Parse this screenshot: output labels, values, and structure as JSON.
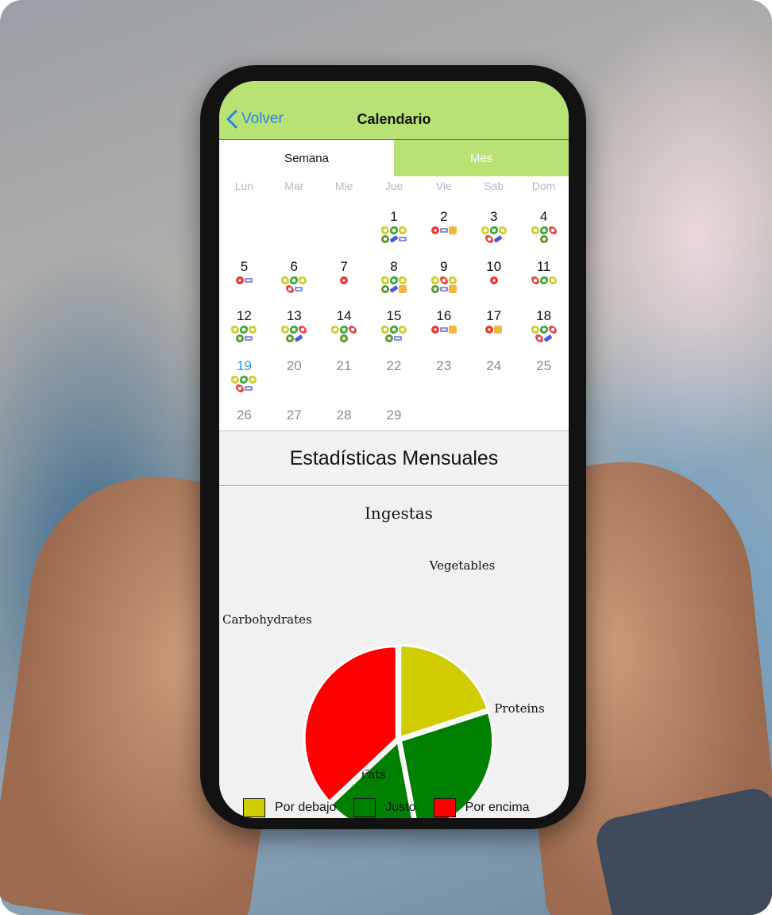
{
  "navbar": {
    "back_label": "Volver",
    "title": "Calendario"
  },
  "tabs": [
    {
      "label": "Semana",
      "active": true
    },
    {
      "label": "Mes",
      "active": false
    }
  ],
  "weekdays": [
    "Lun",
    "Mar",
    "Mie",
    "Jue",
    "Vie",
    "Sab",
    "Dom"
  ],
  "calendar": {
    "days": [
      {
        "day": "",
        "icons": []
      },
      {
        "day": "",
        "icons": []
      },
      {
        "day": "",
        "icons": []
      },
      {
        "day": "1",
        "state": "past",
        "icons": [
          "veg",
          "prot",
          "veg",
          "fat",
          "sport",
          "gym"
        ]
      },
      {
        "day": "2",
        "state": "past",
        "icons": [
          "none",
          "gym",
          "beer"
        ]
      },
      {
        "day": "3",
        "state": "past",
        "icons": [
          "veg",
          "prot",
          "veg",
          "carb",
          "sport"
        ]
      },
      {
        "day": "4",
        "state": "past",
        "icons": [
          "veg",
          "prot",
          "carb",
          "fat"
        ]
      },
      {
        "day": "5",
        "state": "past",
        "icons": [
          "none",
          "gym"
        ]
      },
      {
        "day": "6",
        "state": "past",
        "icons": [
          "veg",
          "prot",
          "veg",
          "carb",
          "gym"
        ]
      },
      {
        "day": "7",
        "state": "past",
        "icons": [
          "none"
        ]
      },
      {
        "day": "8",
        "state": "past",
        "icons": [
          "veg",
          "prot",
          "veg",
          "fat",
          "sport",
          "beer"
        ]
      },
      {
        "day": "9",
        "state": "past",
        "icons": [
          "veg",
          "carb",
          "veg",
          "fat",
          "gym",
          "beer"
        ]
      },
      {
        "day": "10",
        "state": "past",
        "icons": [
          "none"
        ]
      },
      {
        "day": "11",
        "state": "past",
        "icons": [
          "carb",
          "prot",
          "veg"
        ]
      },
      {
        "day": "12",
        "state": "past",
        "icons": [
          "veg",
          "prot",
          "veg",
          "fat",
          "gym"
        ]
      },
      {
        "day": "13",
        "state": "past",
        "icons": [
          "veg",
          "prot",
          "carb",
          "fat",
          "sport"
        ]
      },
      {
        "day": "14",
        "state": "past",
        "icons": [
          "veg",
          "prot",
          "carb",
          "fat"
        ]
      },
      {
        "day": "15",
        "state": "past",
        "icons": [
          "veg",
          "prot",
          "veg",
          "fat",
          "gym"
        ]
      },
      {
        "day": "16",
        "state": "past",
        "icons": [
          "none",
          "gym",
          "beer"
        ]
      },
      {
        "day": "17",
        "state": "past",
        "icons": [
          "none",
          "beer"
        ]
      },
      {
        "day": "18",
        "state": "past",
        "icons": [
          "veg",
          "prot",
          "carb",
          "carb",
          "sport"
        ]
      },
      {
        "day": "19",
        "state": "today",
        "icons": [
          "veg",
          "prot",
          "veg",
          "carb",
          "gym"
        ]
      },
      {
        "day": "20",
        "state": "future",
        "icons": []
      },
      {
        "day": "21",
        "state": "future",
        "icons": []
      },
      {
        "day": "22",
        "state": "future",
        "icons": []
      },
      {
        "day": "23",
        "state": "future",
        "icons": []
      },
      {
        "day": "24",
        "state": "future",
        "icons": []
      },
      {
        "day": "25",
        "state": "future",
        "icons": []
      },
      {
        "day": "26",
        "state": "future",
        "icons": []
      },
      {
        "day": "27",
        "state": "future",
        "icons": []
      },
      {
        "day": "28",
        "state": "future",
        "icons": []
      },
      {
        "day": "29",
        "state": "future",
        "icons": []
      }
    ]
  },
  "stats": {
    "title": "Estadísticas Mensuales"
  },
  "chart_data": {
    "type": "pie",
    "title": "Ingestas",
    "categories": [
      "Vegetables",
      "Proteins",
      "Fats",
      "Carbohydrates"
    ],
    "values": [
      20,
      27,
      16,
      37
    ],
    "colors": [
      "#cfcd00",
      "#008000",
      "#008000",
      "#ff0000"
    ],
    "legend": [
      {
        "label": "Por debajo",
        "color": "#cfcd00"
      },
      {
        "label": "Justo",
        "color": "#008000"
      },
      {
        "label": "Por encima",
        "color": "#ff0000"
      }
    ],
    "legend_position": "bottom"
  }
}
